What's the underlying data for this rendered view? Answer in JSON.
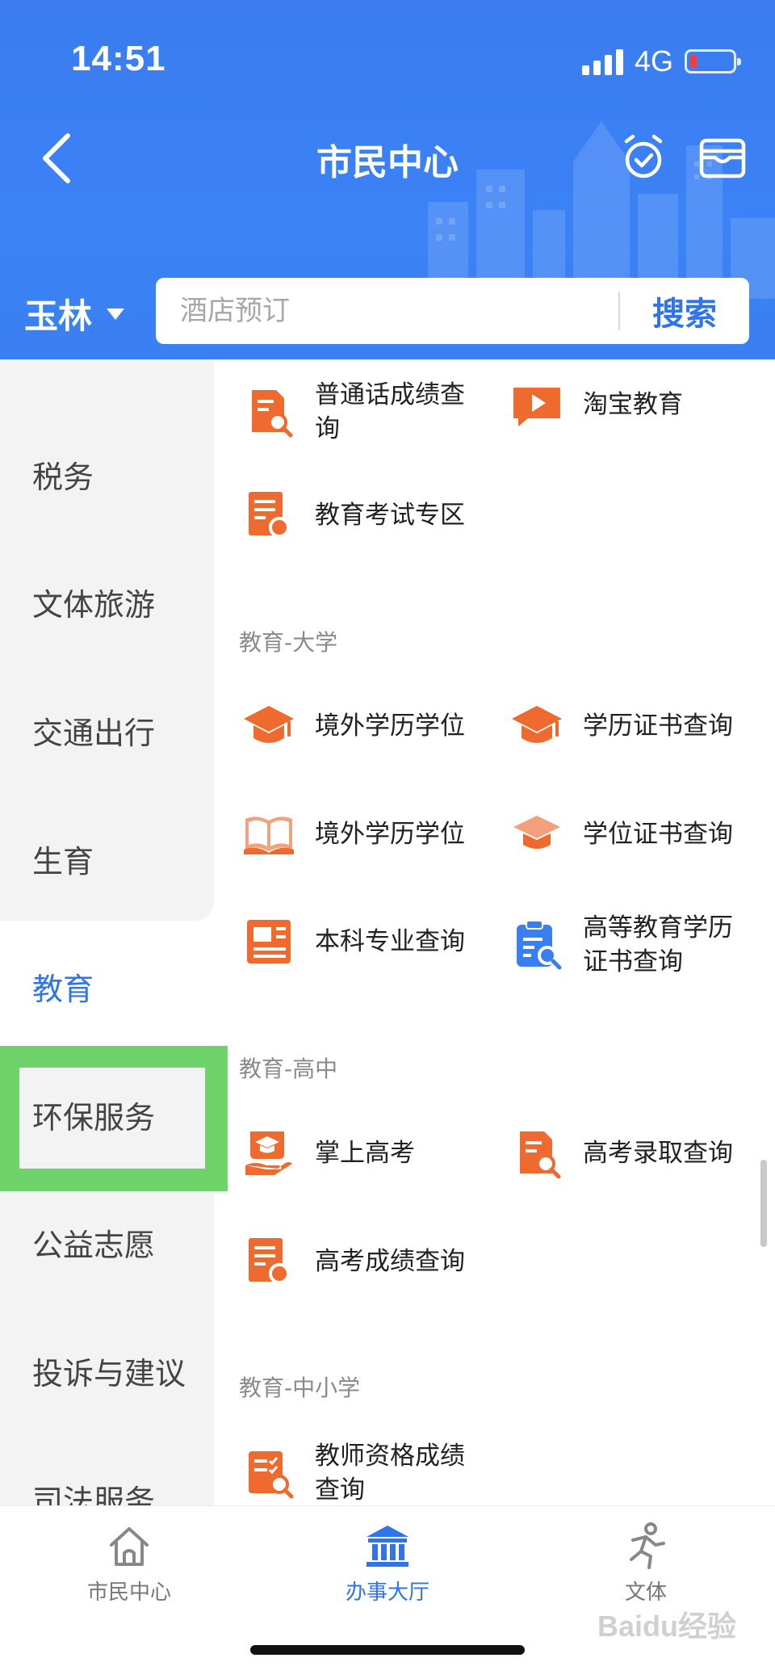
{
  "status_bar": {
    "time": "14:51",
    "network": "4G"
  },
  "header": {
    "title": "市民中心",
    "city": "玉林"
  },
  "search": {
    "placeholder": "酒店预订",
    "button": "搜索"
  },
  "sidebar": {
    "items": [
      "税务",
      "文体旅游",
      "交通出行",
      "生育",
      "教育",
      "环保服务",
      "公益志愿",
      "投诉与建议",
      "司法服务"
    ],
    "active": "教育"
  },
  "content": {
    "top_services": [
      "普通话成绩查询",
      "淘宝教育",
      "教育考试专区"
    ],
    "sections": [
      {
        "label": "教育-大学",
        "services": [
          "境外学历学位",
          "学历证书查询",
          "境外学历学位",
          "学位证书查询",
          "本科专业查询",
          "高等教育学历证书查询"
        ]
      },
      {
        "label": "教育-高中",
        "services": [
          "掌上高考",
          "高考录取查询",
          "高考成绩查询"
        ]
      },
      {
        "label": "教育-中小学",
        "services": [
          "教师资格成绩查询"
        ]
      }
    ]
  },
  "tabbar": {
    "tabs": [
      "市民中心",
      "办事大厅",
      "文体"
    ],
    "active": "办事大厅"
  },
  "watermark": "Baidu经验",
  "colors": {
    "primary": "#3b82f6",
    "accent_text": "#2f74e8",
    "service_icon": "#ee6a2f",
    "highlight": "#6ed36a"
  }
}
